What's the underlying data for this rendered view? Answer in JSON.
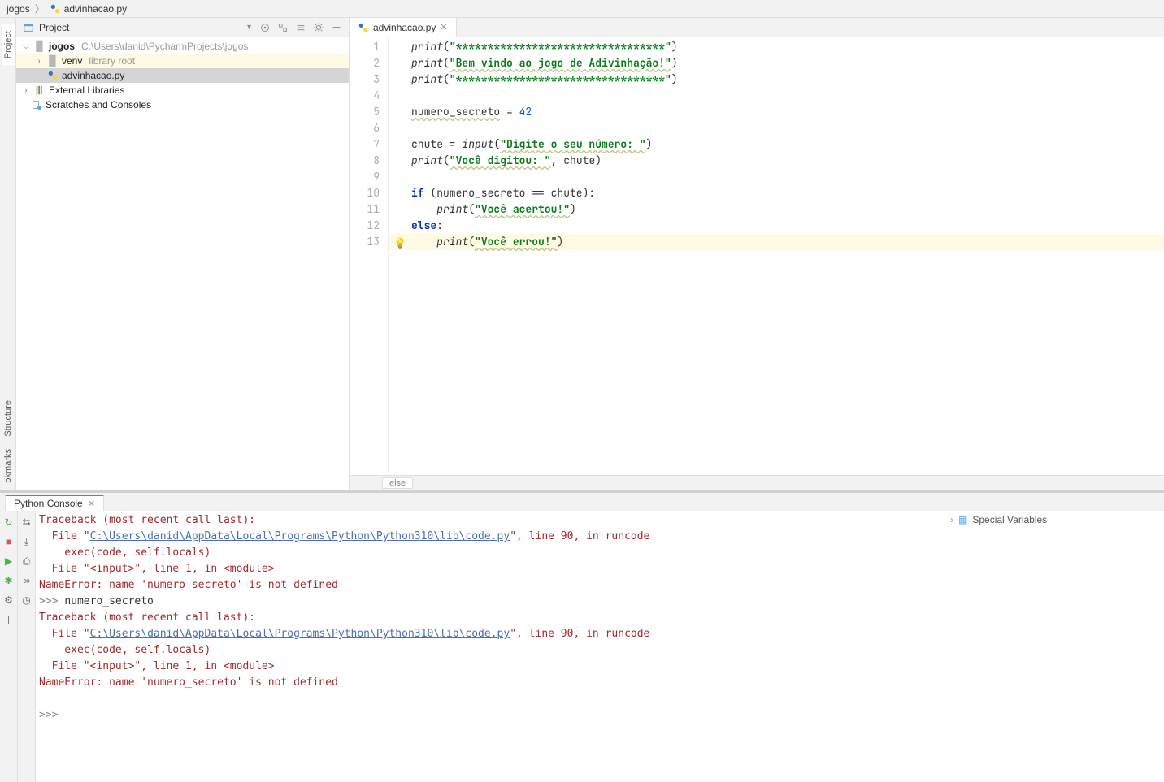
{
  "breadcrumbs": {
    "root": "jogos",
    "file": "advinhacao.py"
  },
  "leftTabs": {
    "project": "Project",
    "structure": "Structure",
    "bookmarks": "okmarks"
  },
  "projectPanel": {
    "title": "Project",
    "rootName": "jogos",
    "rootPath": "C:\\Users\\danid\\PycharmProjects\\jogos",
    "venv": "venv",
    "venvHint": "library root",
    "file": "advinhacao.py",
    "extLib": "External Libraries",
    "scratches": "Scratches and Consoles"
  },
  "editor": {
    "tab": "advinhacao.py",
    "breadcrumb": "else",
    "currentLine": 13,
    "lines": [
      {
        "fn": "print",
        "op": "(",
        "str": "\"*********************************\"",
        "cl": ")"
      },
      {
        "fn": "print",
        "op": "(",
        "strU": "\"Bem vindo ao jogo de Adivinhação!\"",
        "cl": ")"
      },
      {
        "fn": "print",
        "op": "(",
        "str": "\"*********************************\"",
        "cl": ")"
      },
      {
        "blank": true
      },
      {
        "varU": "numero_secreto",
        "assign": " = ",
        "num": "42"
      },
      {
        "blank": true
      },
      {
        "var": "chute",
        "assign": " = ",
        "fn": "input",
        "op": "(",
        "strU": "\"Digite o seu número: \"",
        "cl": ")"
      },
      {
        "fn": "print",
        "op": "(",
        "strU": "\"Você digitou: \"",
        "rest": ", chute)"
      },
      {
        "blank": true
      },
      {
        "kw": "if ",
        "rest": "(numero_secreto == chute):"
      },
      {
        "indent": "    ",
        "fn": "print",
        "op": "(",
        "strU": "\"Você acertou!\"",
        "cl": ")"
      },
      {
        "kw": "else",
        "rest": ":"
      },
      {
        "indent": "    ",
        "fn": "print",
        "op": "(",
        "strU": "\"Você errou!\"",
        "cl": ")"
      }
    ]
  },
  "console": {
    "tab": "Python Console",
    "specialVars": "Special Variables",
    "output": {
      "trace": "Traceback (most recent call last):",
      "filePrefix": "  File \"",
      "filePath": "C:\\Users\\danid\\AppData\\Local\\Programs\\Python\\Python310\\lib\\code.py",
      "fileSuffix": "\", line 90, in runcode",
      "exec": "    exec(code, self.locals)",
      "inputLine": "  File \"<input>\", line 1, in <module>",
      "nameErr": "NameError: name 'numero_secreto' is not defined",
      "prompt": ">>> ",
      "entered": "numero_secreto"
    }
  }
}
